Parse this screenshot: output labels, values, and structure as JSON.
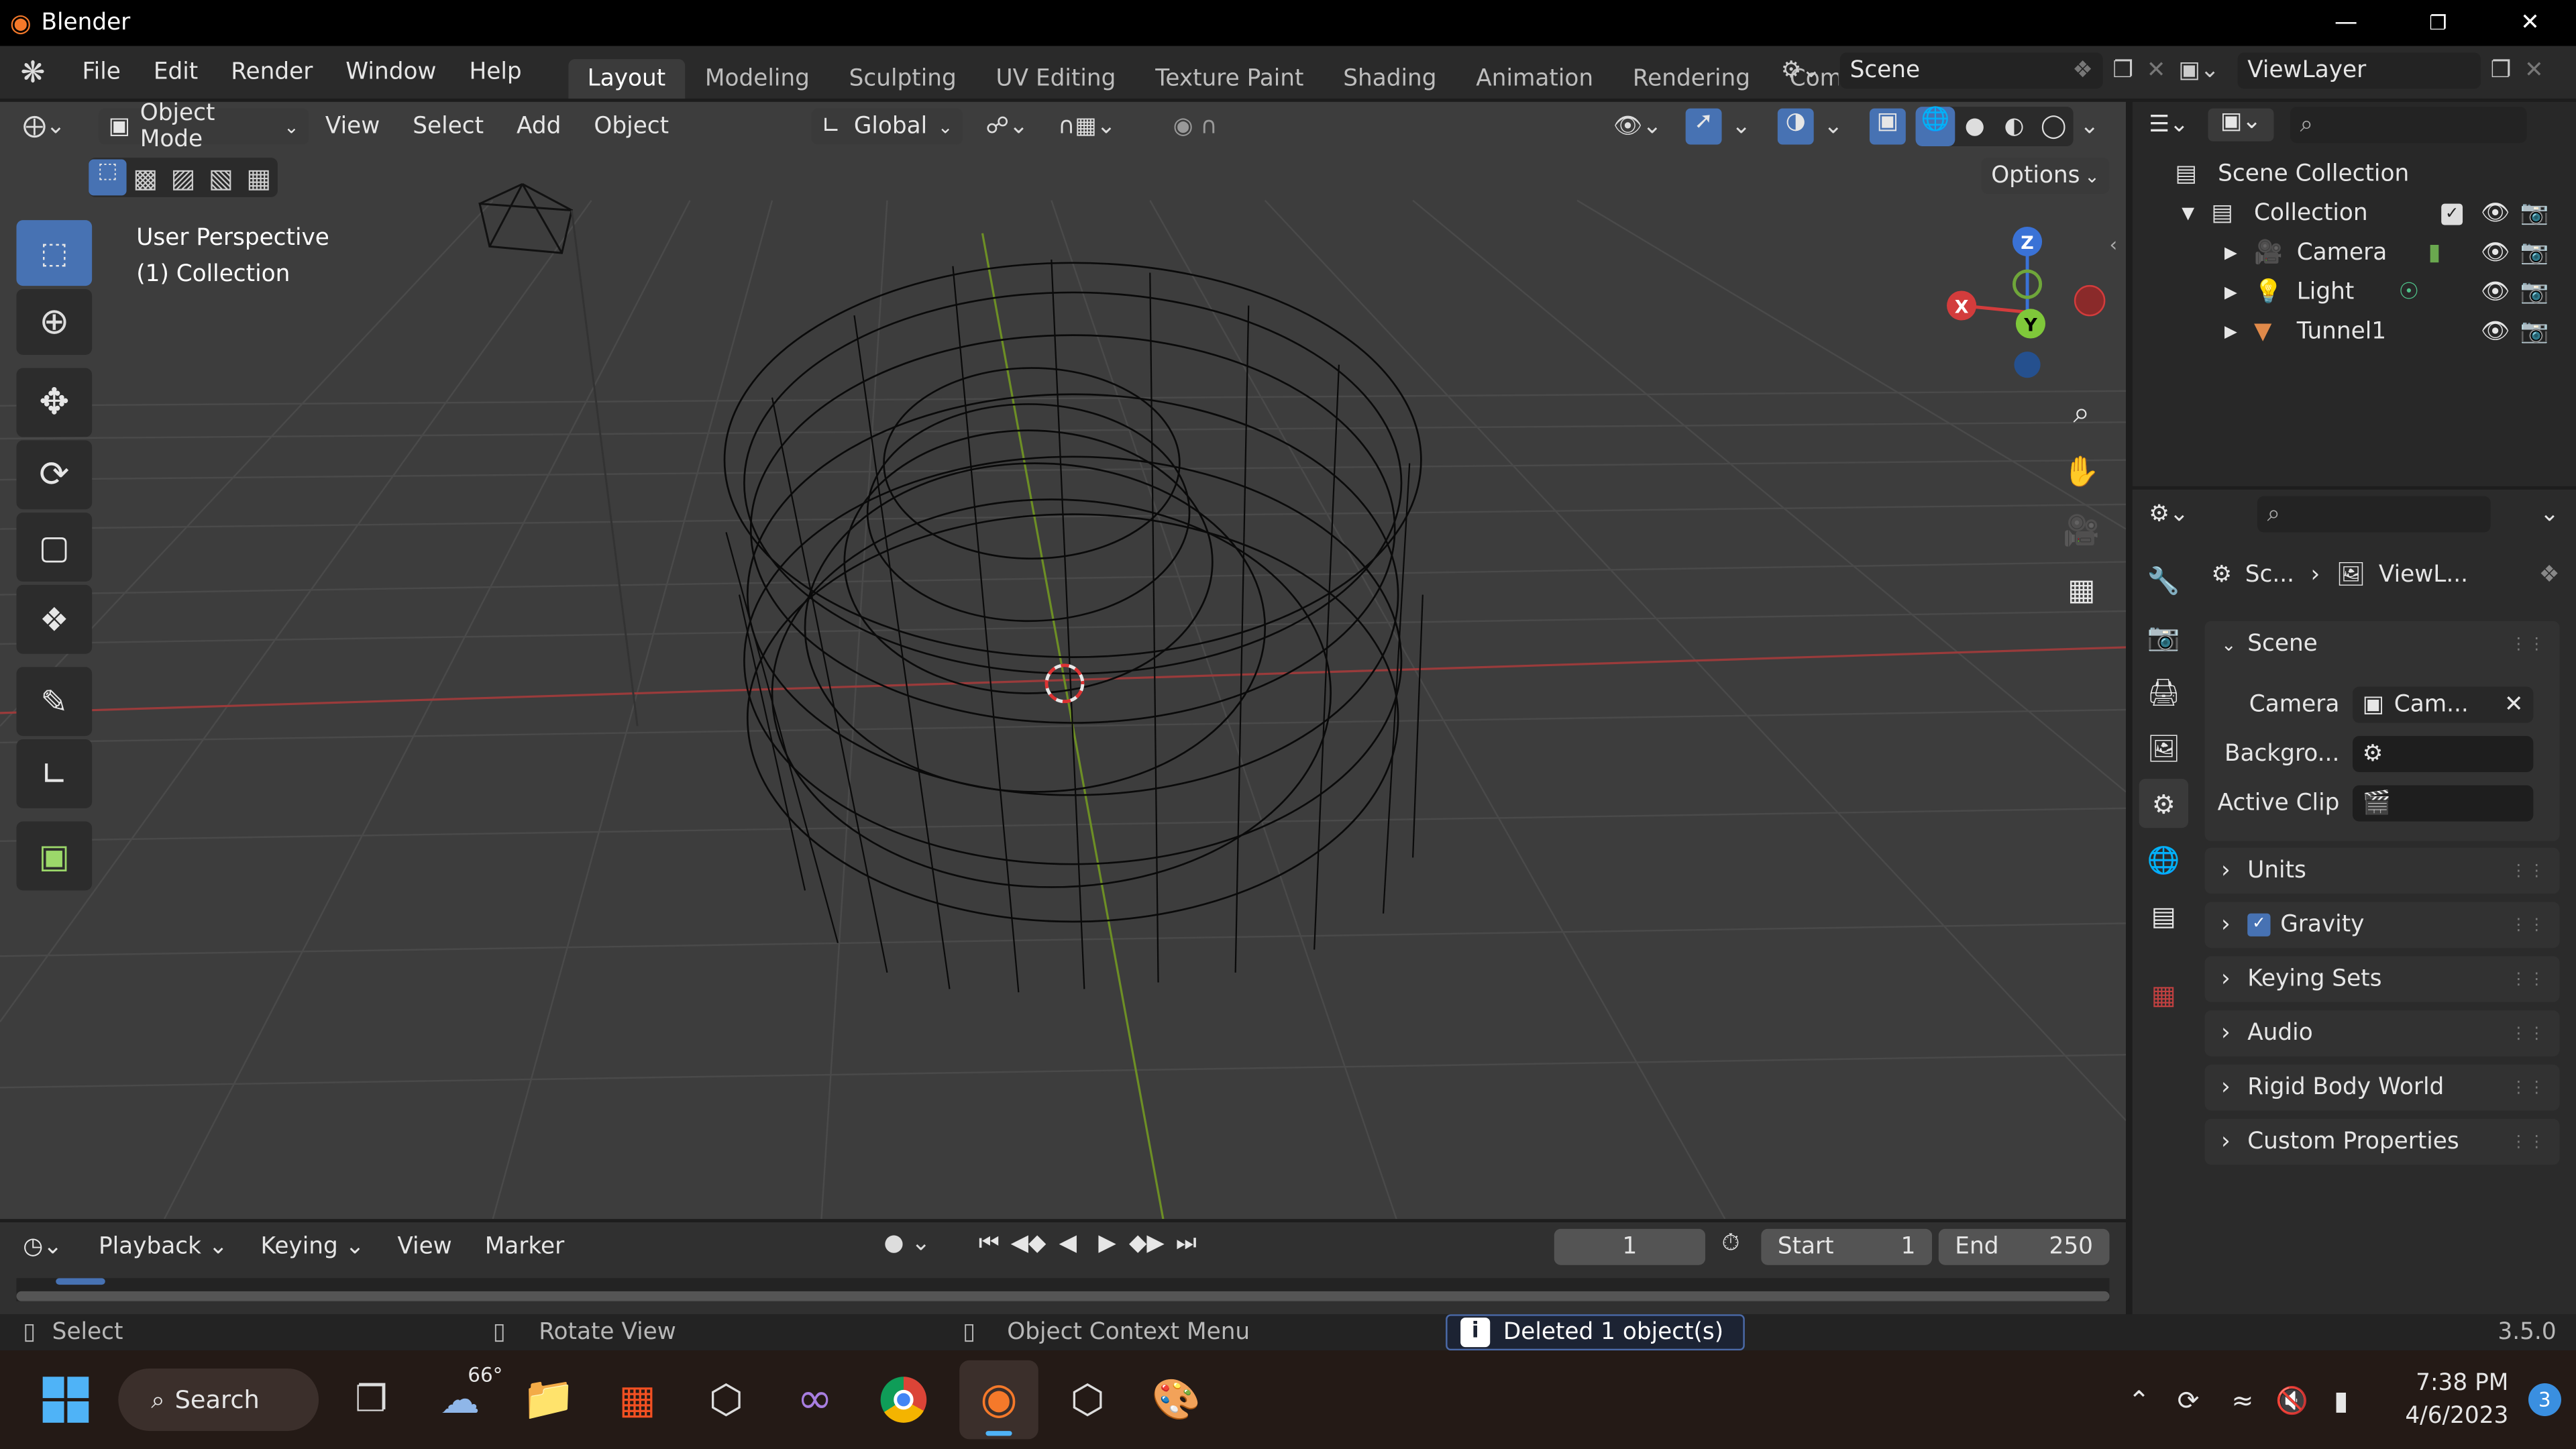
{
  "app": {
    "title": "Blender",
    "version": "3.5.0"
  },
  "menu": [
    "File",
    "Edit",
    "Render",
    "Window",
    "Help"
  ],
  "workspaces": [
    {
      "label": "Layout",
      "active": true
    },
    {
      "label": "Modeling"
    },
    {
      "label": "Sculpting"
    },
    {
      "label": "UV Editing"
    },
    {
      "label": "Texture Paint"
    },
    {
      "label": "Shading"
    },
    {
      "label": "Animation"
    },
    {
      "label": "Rendering"
    },
    {
      "label": "Comp"
    }
  ],
  "scene_field": "Scene",
  "viewlayer_field": "ViewLayer",
  "viewport": {
    "mode": "Object Mode",
    "menus": [
      "View",
      "Select",
      "Add",
      "Object"
    ],
    "orientation": "Global",
    "options_label": "Options",
    "perspective": "User Perspective",
    "collection": "(1) Collection",
    "gizmo": {
      "z": "Z",
      "y": "Y",
      "x": "X"
    }
  },
  "outliner": {
    "root": "Scene Collection",
    "collection": "Collection",
    "items": [
      {
        "label": "Camera",
        "icon": "camera-icon"
      },
      {
        "label": "Light",
        "icon": "light-icon"
      },
      {
        "label": "Tunnel1",
        "icon": "mesh-icon"
      }
    ]
  },
  "properties": {
    "breadcrumb": [
      "Sc...",
      "ViewL..."
    ],
    "scene_panel": "Scene",
    "fields": [
      {
        "label": "Camera",
        "value": "Cam..."
      },
      {
        "label": "Backgro...",
        "value": ""
      },
      {
        "label": "Active Clip",
        "value": ""
      }
    ],
    "panels": [
      "Units",
      "Gravity",
      "Keying Sets",
      "Audio",
      "Rigid Body World",
      "Custom Properties"
    ]
  },
  "timeline": {
    "menus": [
      "Playback",
      "Keying",
      "View",
      "Marker"
    ],
    "current_frame": "1",
    "start_label": "Start",
    "start": "1",
    "end_label": "End",
    "end": "250"
  },
  "status": {
    "select": "Select",
    "rotate": "Rotate View",
    "context": "Object Context Menu",
    "message": "Deleted 1 object(s)"
  },
  "taskbar": {
    "search": "Search",
    "weather": "66°",
    "time": "7:38 PM",
    "date": "4/6/2023",
    "notifications": "3"
  }
}
